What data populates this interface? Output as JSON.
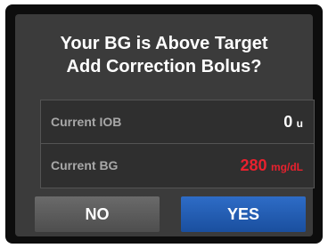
{
  "dialog": {
    "title_line1": "Your BG is Above Target",
    "title_line2": "Add Correction Bolus?"
  },
  "info": {
    "iob": {
      "label": "Current IOB",
      "value": "0",
      "unit": "u"
    },
    "bg": {
      "label": "Current BG",
      "value": "280",
      "unit": "mg/dL",
      "color": "#e8212e"
    }
  },
  "buttons": {
    "no_label": "NO",
    "yes_label": "YES"
  },
  "colors": {
    "yes_button": "#2463b8",
    "no_button": "#5c5c5c",
    "alert_text": "#e8212e"
  }
}
